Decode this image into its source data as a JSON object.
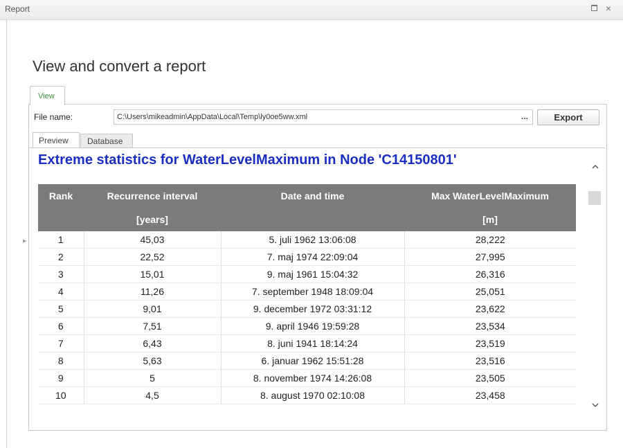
{
  "window": {
    "title": "Report"
  },
  "page": {
    "heading": "View and convert a report"
  },
  "tabs": {
    "view": "View"
  },
  "file": {
    "label": "File name:",
    "value": "C:\\Users\\mikeadmin\\AppData\\Local\\Temp\\ly0oe5ww.xml",
    "browse": "...",
    "export": "Export"
  },
  "subtabs": {
    "preview": "Preview",
    "database": "Database"
  },
  "report": {
    "title": "Extreme statistics for WaterLevelMaximum in Node 'C14150801'",
    "headers": [
      "Rank",
      "Recurrence interval",
      "Date and time",
      "Max WaterLevelMaximum"
    ],
    "units": [
      "",
      "[years]",
      "",
      "[m]"
    ],
    "rows": [
      [
        "1",
        "45,03",
        "5. juli 1962 13:06:08",
        "28,222"
      ],
      [
        "2",
        "22,52",
        "7. maj 1974 22:09:04",
        "27,995"
      ],
      [
        "3",
        "15,01",
        "9. maj 1961 15:04:32",
        "26,316"
      ],
      [
        "4",
        "11,26",
        "7. september 1948 18:09:04",
        "25,051"
      ],
      [
        "5",
        "9,01",
        "9. december 1972 03:31:12",
        "23,622"
      ],
      [
        "6",
        "7,51",
        "9. april 1946 19:59:28",
        "23,534"
      ],
      [
        "7",
        "6,43",
        "8. juni 1941 18:14:24",
        "23,519"
      ],
      [
        "8",
        "5,63",
        "6. januar 1962 15:51:28",
        "23,516"
      ],
      [
        "9",
        "5",
        "8. november 1974 14:26:08",
        "23,505"
      ],
      [
        "10",
        "4,5",
        "8. august 1970 02:10:08",
        "23,458"
      ]
    ]
  },
  "icons": {
    "maximize": "maximize-icon",
    "close": "close-icon",
    "scroll_up": "chevron-up-icon",
    "scroll_down": "chevron-down-icon"
  }
}
